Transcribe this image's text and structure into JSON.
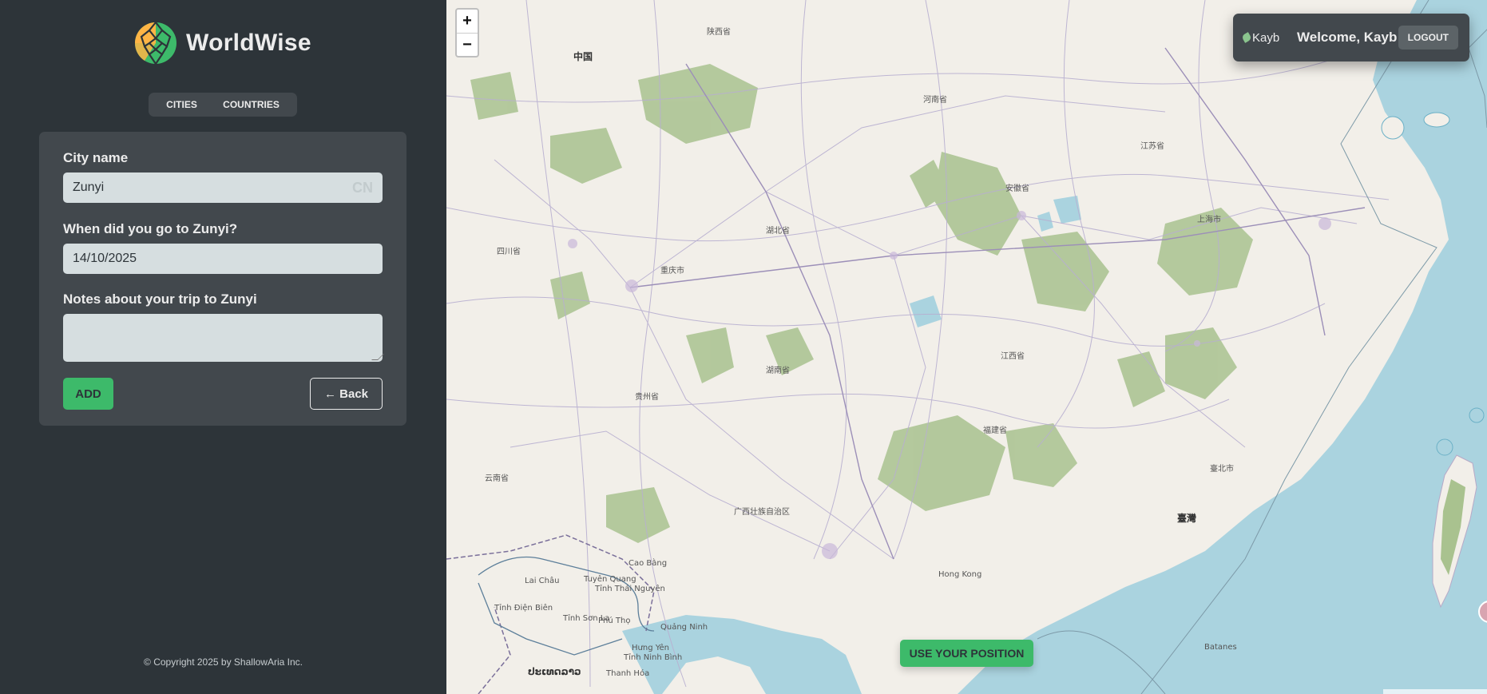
{
  "app": {
    "name": "WorldWise",
    "tabs": [
      "Cities",
      "Countries"
    ],
    "footer": "© Copyright 2025 by ShallowAria Inc."
  },
  "form": {
    "city_label": "City name",
    "city_value": "Zunyi",
    "country_code": "CN",
    "date_label": "When did you go to Zunyi?",
    "date_value": "14/10/2025",
    "notes_label": "Notes about your trip to Zunyi",
    "notes_value": "",
    "add_label": "Add",
    "back_label": "← Back"
  },
  "map": {
    "zoom_in": "+",
    "zoom_out": "−",
    "use_position_label": "Use your position",
    "labels": {
      "china": "中国",
      "taiwan": "臺灣",
      "taipei": "臺北市",
      "hongkong": "Hong Kong",
      "sichuan": "四川省",
      "hubei": "湖北省",
      "chongqing": "重庆市",
      "guizhou": "贵州省",
      "hunan": "湖南省",
      "jiangxi": "江西省",
      "fujian": "福建省",
      "yunnan": "云南省",
      "guangxi": "广西壮族自治区",
      "anhui": "安徽省",
      "jiangsu": "江苏省",
      "henan": "河南省",
      "shaanxi": "陕西省",
      "shanghai": "上海市",
      "laos": "ປະເທດລາວ",
      "caobang": "Cao Bằng",
      "tuyenquang": "Tuyên Quang",
      "thainguyen": "Tỉnh Thái Nguyên",
      "laichau": "Lai Châu",
      "dienbien": "Tỉnh Điện Biên",
      "sonla": "Tỉnh Sơn La",
      "phutho": "Phú Thọ",
      "quangninh": "Quảng Ninh",
      "hungyen": "Hưng Yên",
      "ninhbinh": "Tỉnh Ninh Bình",
      "thanhhoa": "Thanh Hóa",
      "batanes": "Batanes"
    }
  },
  "user": {
    "avatar_alt": "Kayb",
    "welcome": "Welcome, Kayb",
    "logout_label": "Logout"
  },
  "colors": {
    "dark": "#2d3439",
    "panel": "#42484d",
    "brand": "#3dba6a",
    "sea": "#aad3df",
    "land": "#f2efe9",
    "forest": "#a9c28f"
  }
}
